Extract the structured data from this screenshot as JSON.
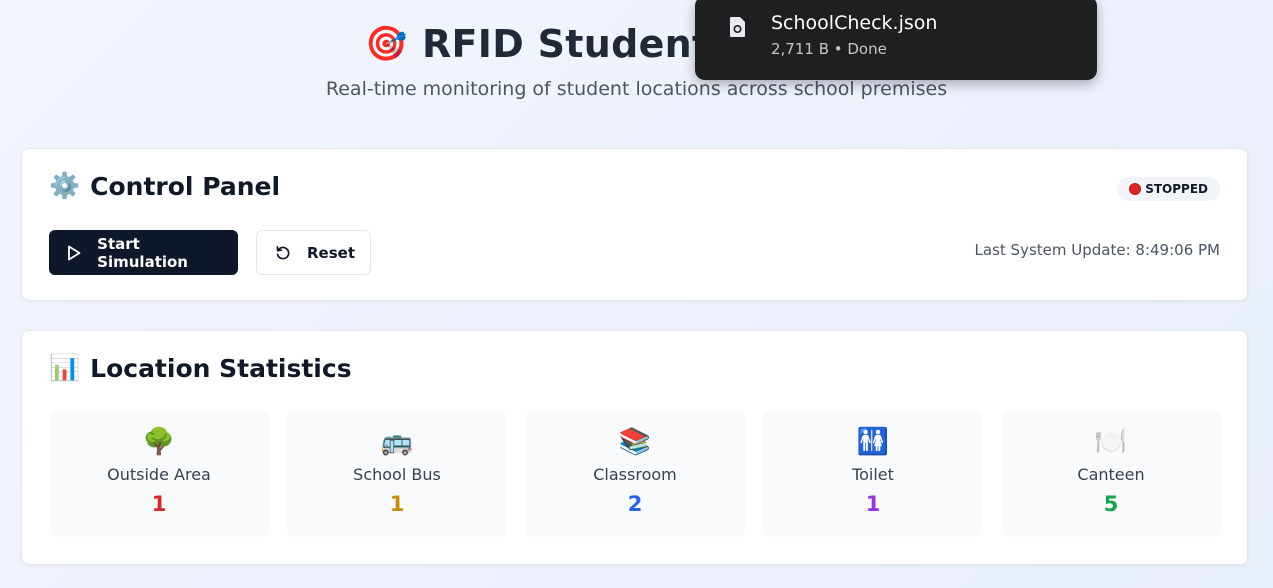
{
  "header": {
    "title_emoji": "🎯",
    "title": "RFID Student Tracking",
    "subtitle": "Real-time monitoring of student locations across school premises"
  },
  "control_panel": {
    "emoji": "⚙️",
    "title": "Control Panel",
    "status_badge": "STOPPED",
    "start_button": "Start Simulation",
    "reset_button": "Reset",
    "last_update": "Last System Update: 8:49:06 PM"
  },
  "statistics": {
    "emoji": "📊",
    "title": "Location Statistics",
    "locations": [
      {
        "emoji": "🌳",
        "label": "Outside Area",
        "count": "1",
        "color": "#dc2626"
      },
      {
        "emoji": "🚌",
        "label": "School Bus",
        "count": "1",
        "color": "#ca8a04"
      },
      {
        "emoji": "📚",
        "label": "Classroom",
        "count": "2",
        "color": "#2563eb"
      },
      {
        "emoji": "🚻",
        "label": "Toilet",
        "count": "1",
        "color": "#9333ea"
      },
      {
        "emoji": "🍽️",
        "label": "Canteen",
        "count": "5",
        "color": "#16a34a"
      }
    ]
  },
  "download": {
    "file_name": "SchoolCheck.json",
    "meta": "2,711 B • Done"
  }
}
